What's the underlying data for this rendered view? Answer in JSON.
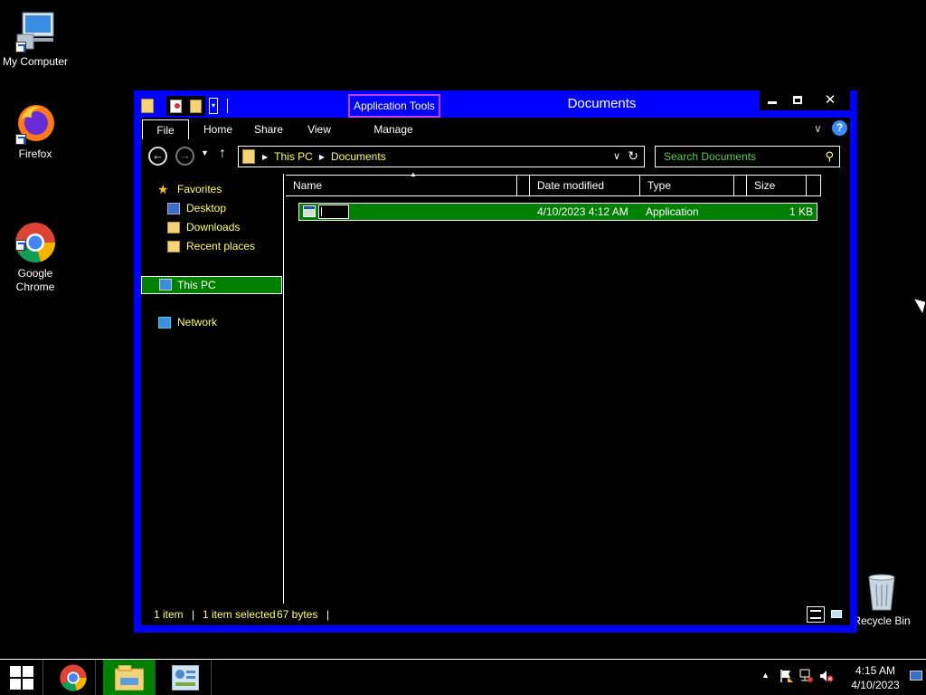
{
  "desktop": {
    "icons": [
      {
        "label": "My Computer"
      },
      {
        "label": "Firefox"
      },
      {
        "label": "Google\nChrome"
      },
      {
        "label": "Recycle Bin"
      }
    ]
  },
  "window": {
    "title": "Documents",
    "contextual_tab": "Application Tools",
    "ribbon_tabs": [
      "File",
      "Home",
      "Share",
      "View",
      "Manage"
    ],
    "address": {
      "crumbs": [
        "This PC",
        "Documents"
      ]
    },
    "search": {
      "placeholder": "Search Documents"
    },
    "nav_pane": {
      "favorites": "Favorites",
      "items": [
        "Desktop",
        "Downloads",
        "Recent places"
      ],
      "this_pc": "This PC",
      "network": "Network"
    },
    "columns": [
      "Name",
      "Date modified",
      "Type",
      "Size"
    ],
    "files": [
      {
        "name": "",
        "date_modified": "4/10/2023 4:12 AM",
        "type": "Application",
        "size": "1 KB"
      }
    ],
    "status": {
      "item_count": "1 item",
      "selected": "1 item selected",
      "bytes": "67 bytes"
    }
  },
  "taskbar": {
    "time": "4:15 AM",
    "date": "4/10/2023"
  },
  "colors": {
    "window_frame": "#0000ff",
    "selection": "#008000",
    "text_yellow": "#ffff66",
    "search_green": "#4fd04f",
    "contextual_border": "#c040ff"
  }
}
